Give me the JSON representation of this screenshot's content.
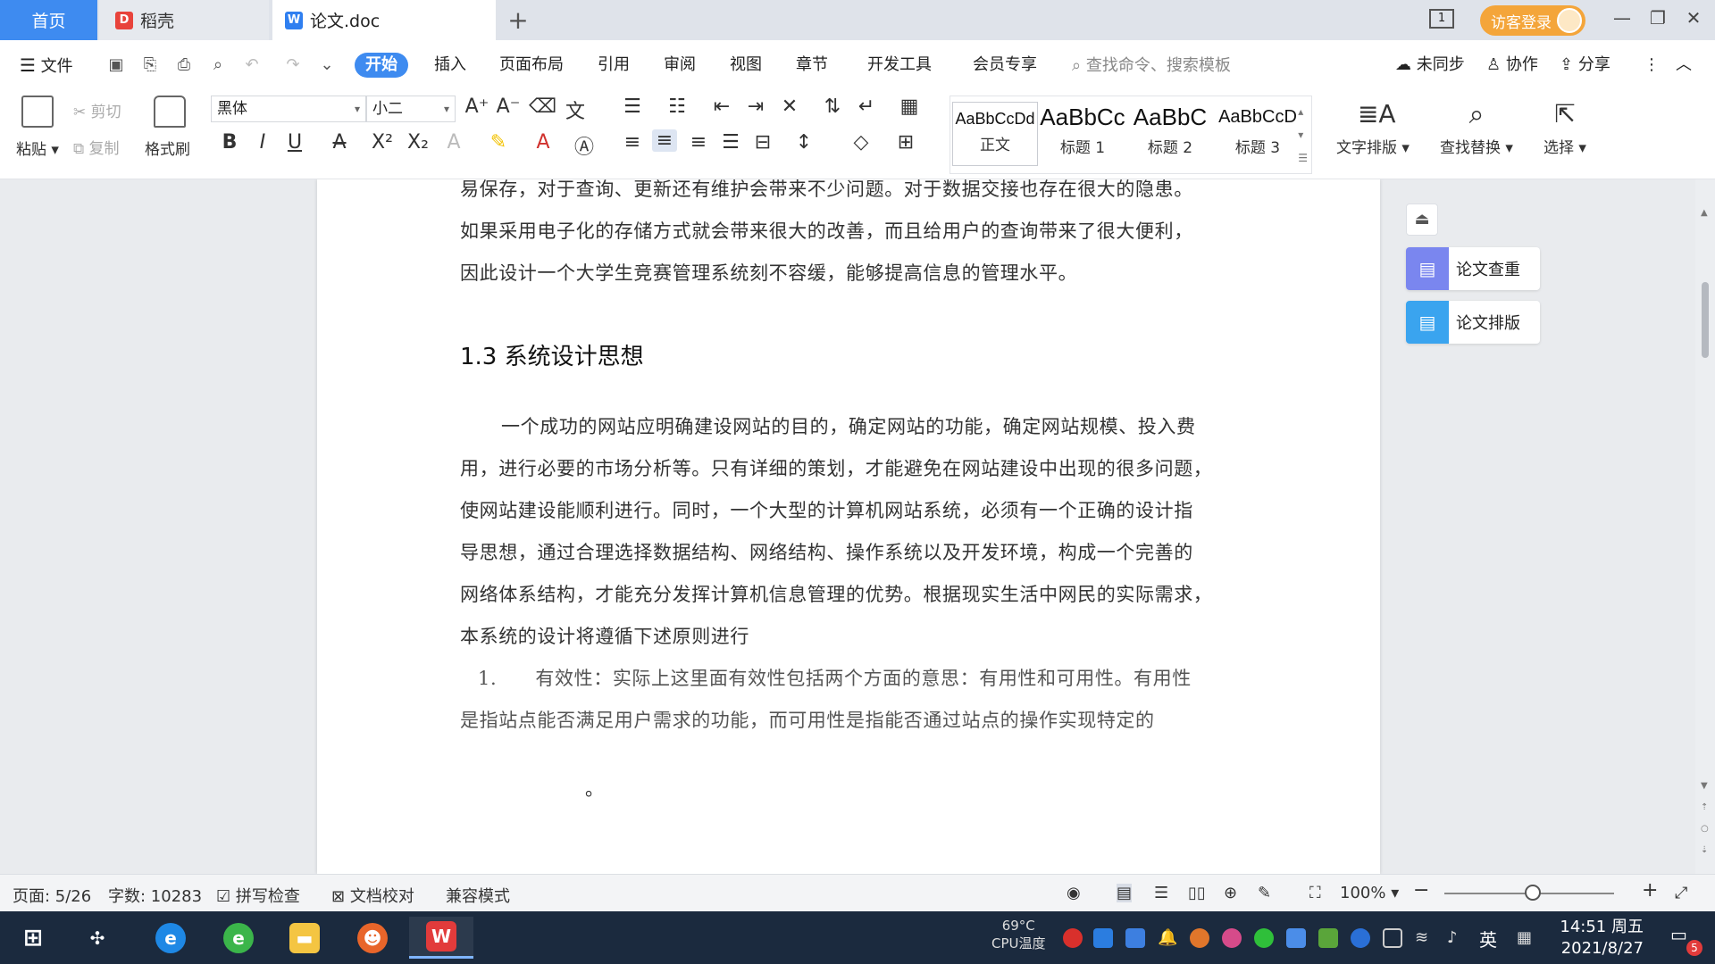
{
  "tabs": {
    "home": "首页",
    "daoke": "稻壳",
    "doc": "论文.doc",
    "add": "+"
  },
  "titlebar": {
    "page_badge": "1",
    "login": "访客登录"
  },
  "menu": {
    "file": "文件",
    "items": [
      "开始",
      "插入",
      "页面布局",
      "引用",
      "审阅",
      "视图",
      "章节",
      "开发工具",
      "会员专享"
    ],
    "search": "查找命令、搜索模板",
    "sync": "未同步",
    "collab": "协作",
    "share": "分享"
  },
  "ribbon": {
    "paste": "粘贴",
    "cut": "剪切",
    "copy": "复制",
    "format_painter": "格式刷",
    "font_name": "黑体",
    "font_size": "小二",
    "styles": [
      {
        "sample": "AaBbCcDd",
        "name": "正文"
      },
      {
        "sample": "AaBbCc",
        "name": "标题 1"
      },
      {
        "sample": "AaBbC",
        "name": "标题 2"
      },
      {
        "sample": "AaBbCcD",
        "name": "标题 3"
      }
    ],
    "text_layout": "文字排版",
    "find_replace": "查找替换",
    "select": "选择"
  },
  "document": {
    "para1_lines": [
      "易保存，对于查询、更新还有维护会带来不少问题。对于数据交接也存在很大的隐患。",
      "如果采用电子化的存储方式就会带来很大的改善，而且给用户的查询带来了很大便利，",
      "因此设计一个大学生竞赛管理系统刻不容缓，能够提高信息的管理水平。"
    ],
    "heading": "1.3 系统设计思想",
    "para2_lines": [
      "一个成功的网站应明确建设网站的目的，确定网站的功能，确定网站规模、投入费",
      "用，进行必要的市场分析等。只有详细的策划，才能避免在网站建设中出现的很多问题，",
      "使网站建设能顺利进行。同时，一个大型的计算机网站系统，必须有一个正确的设计指",
      "导思想，通过合理选择数据结构、网络结构、操作系统以及开发环境，构成一个完善的",
      "网络体系结构，才能充分发挥计算机信息管理的优势。根据现实生活中网民的实际需求，",
      "本系统的设计将遵循下述原则进行"
    ],
    "list_item1_lines": [
      "1.　　有效性：实际上这里面有效性包括两个方面的意思：有用性和可用性。有用性",
      "是指站点能否满足用户需求的功能，而可用性是指能否通过站点的操作实现特定的"
    ],
    "fragment": "。"
  },
  "side_panel": {
    "check": "论文查重",
    "layout": "论文排版"
  },
  "status": {
    "page": "页面: 5/26",
    "words": "字数: 10283",
    "spell": "拼写检查",
    "proof": "文档校对",
    "compat": "兼容模式",
    "zoom": "100%"
  },
  "taskbar": {
    "cpu_temp": "69°C",
    "cpu_label": "CPU温度",
    "ime": "英",
    "time": "14:51 周五",
    "date": "2021/8/27",
    "notify_count": "5"
  }
}
